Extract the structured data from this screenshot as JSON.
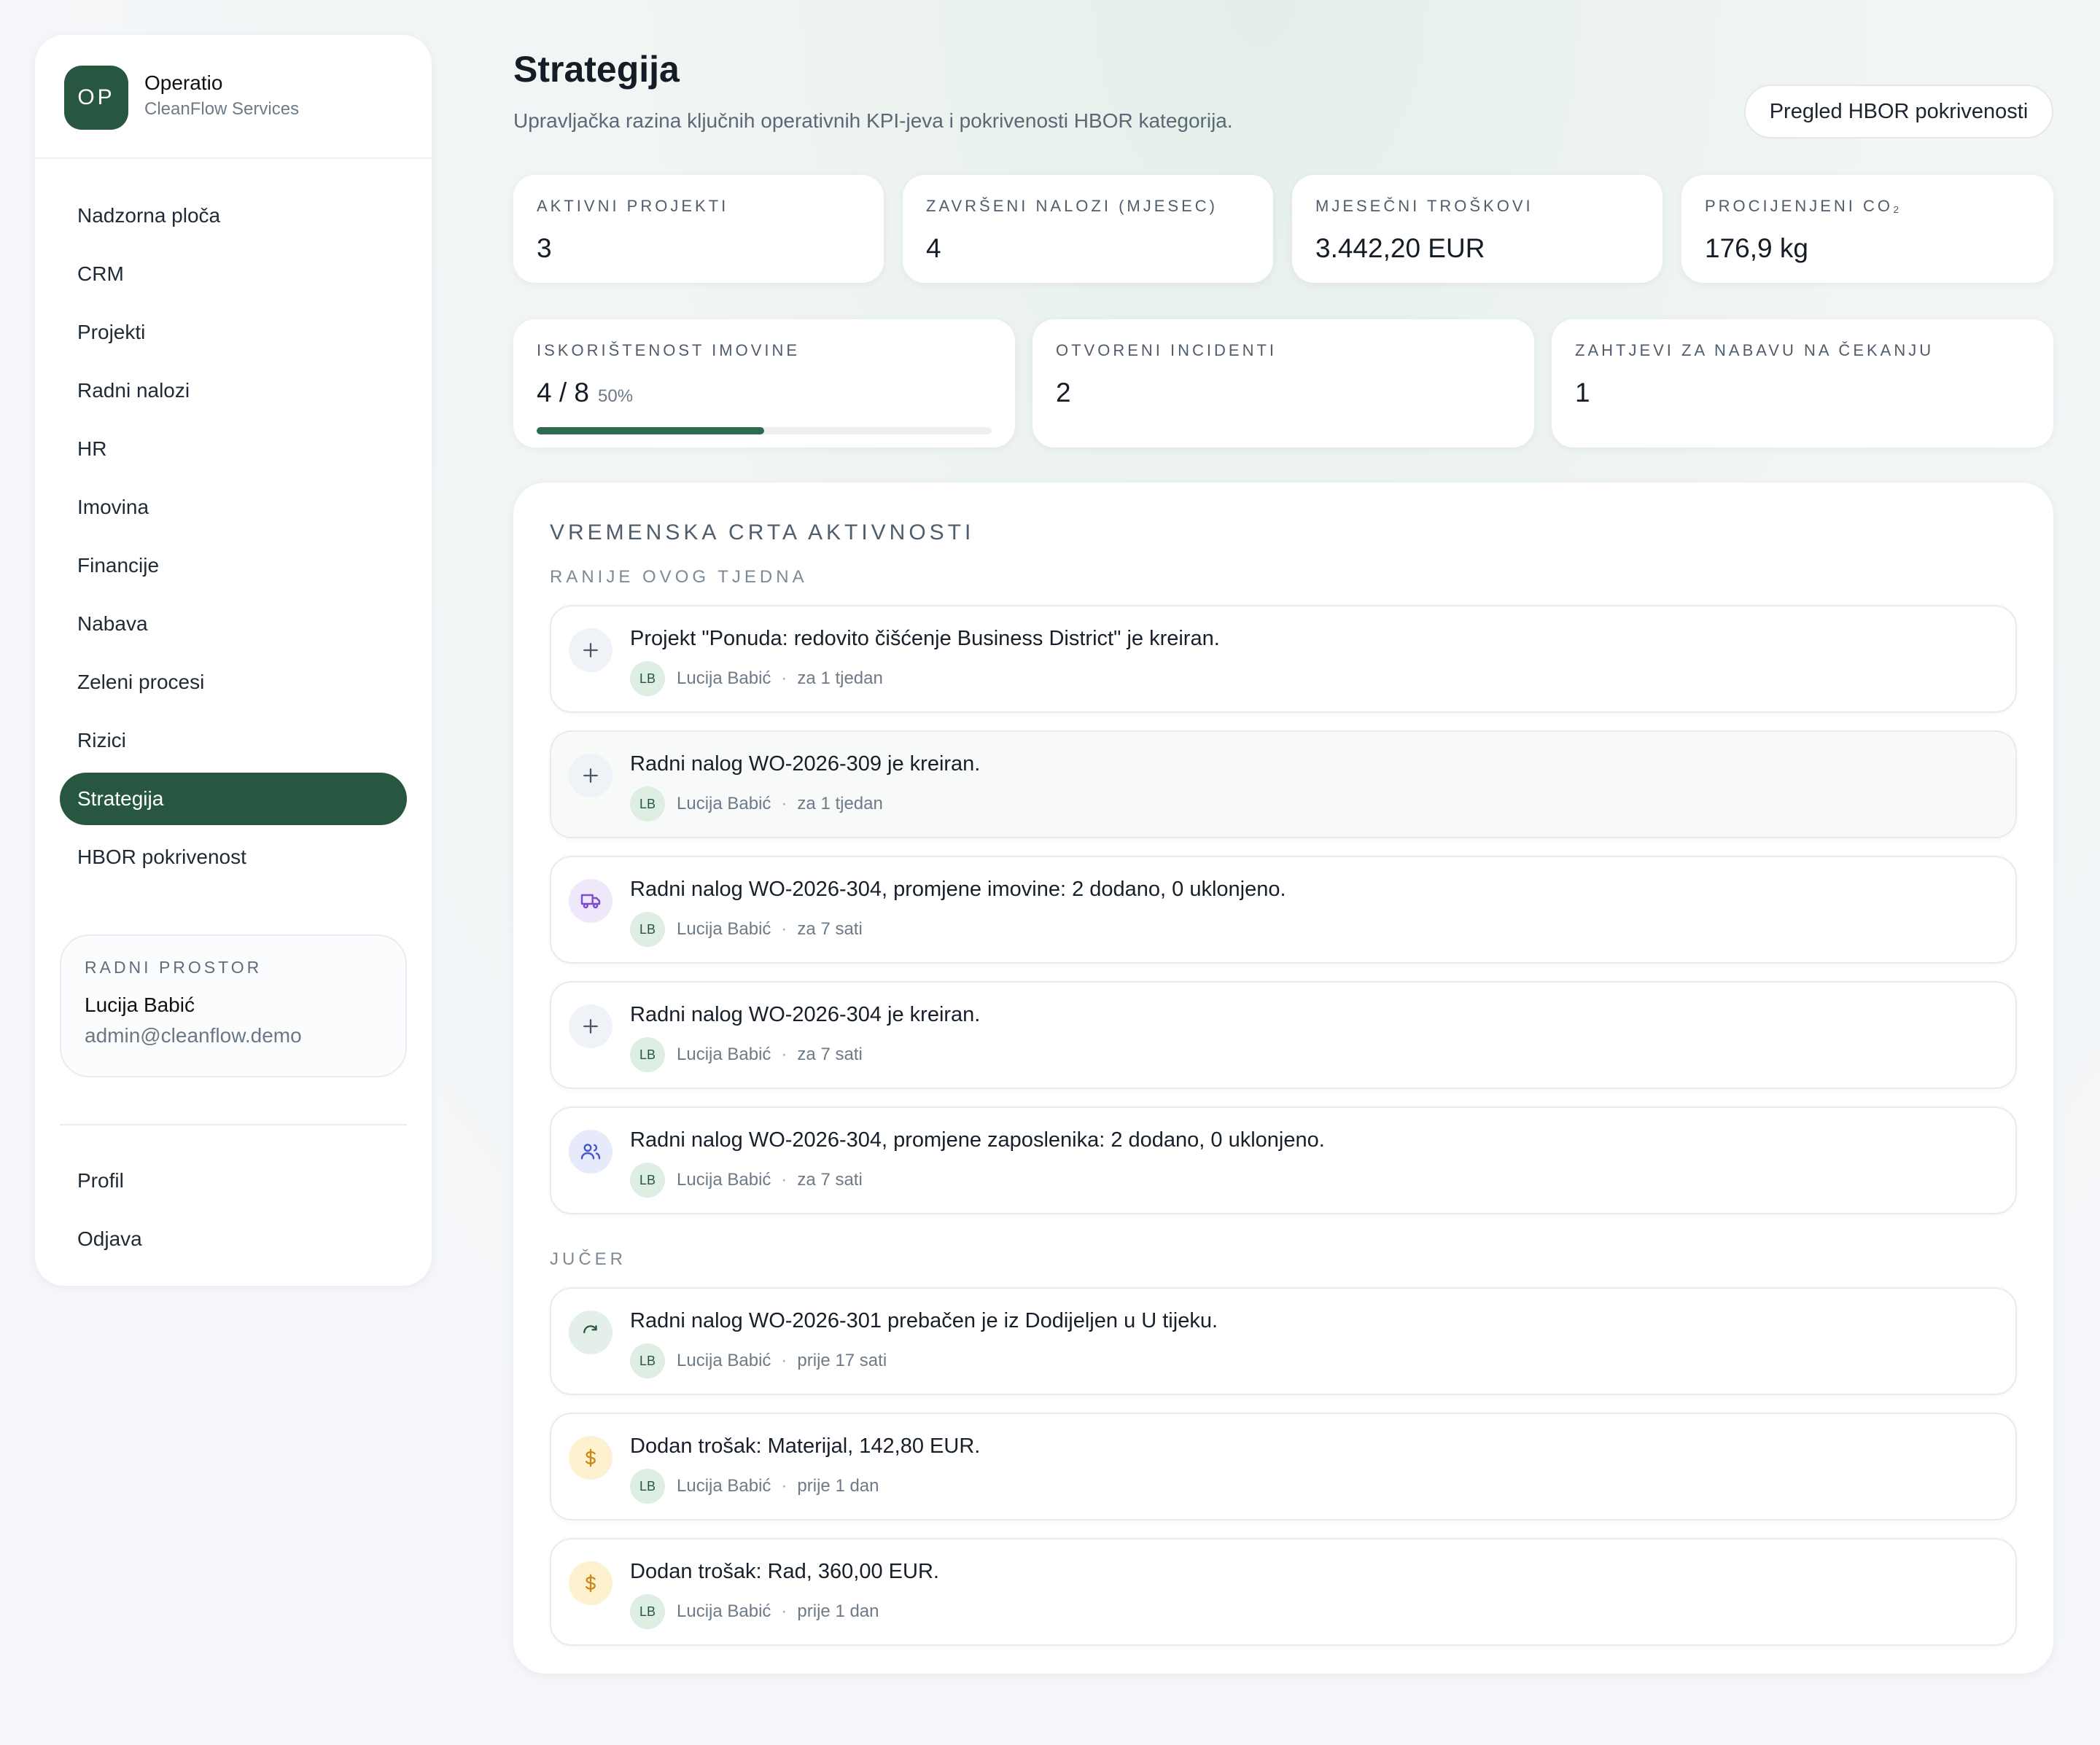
{
  "brand": {
    "logo": "OP",
    "name": "Operatio",
    "sub": "CleanFlow Services"
  },
  "nav": [
    {
      "label": "Nadzorna ploča"
    },
    {
      "label": "CRM"
    },
    {
      "label": "Projekti"
    },
    {
      "label": "Radni nalozi"
    },
    {
      "label": "HR"
    },
    {
      "label": "Imovina"
    },
    {
      "label": "Financije"
    },
    {
      "label": "Nabava"
    },
    {
      "label": "Zeleni procesi"
    },
    {
      "label": "Rizici"
    },
    {
      "label": "Strategija",
      "active": true
    },
    {
      "label": "HBOR pokrivenost"
    }
  ],
  "workspace": {
    "title": "RADNI PROSTOR",
    "name": "Lucija Babić",
    "email": "admin@cleanflow.demo"
  },
  "nav_bottom": [
    {
      "label": "Profil"
    },
    {
      "label": "Odjava"
    }
  ],
  "header": {
    "title": "Strategija",
    "subtitle": "Upravljačka razina ključnih operativnih KPI-jeva i pokrivenosti HBOR kategorija.",
    "button": "Pregled HBOR pokrivenosti"
  },
  "kpis_row1": [
    {
      "label": "AKTIVNI PROJEKTI",
      "value": "3"
    },
    {
      "label": "ZAVRŠENI NALOZI (MJESEC)",
      "value": "4"
    },
    {
      "label": "MJESEČNI TROŠKOVI",
      "value": "3.442,20 EUR"
    },
    {
      "label": "PROCIJENJENI CO₂",
      "value": "176,9 kg"
    }
  ],
  "kpis_row2": [
    {
      "label": "ISKORIŠTENOST IMOVINE",
      "value": "4 / 8",
      "pct": "50%",
      "progress": 0.5
    },
    {
      "label": "OTVORENI INCIDENTI",
      "value": "2"
    },
    {
      "label": "ZAHTJEVI ZA NABAVU NA ČEKANJU",
      "value": "1"
    }
  ],
  "timeline": {
    "title": "VREMENSKA CRTA AKTIVNOSTI",
    "groups": [
      {
        "label": "RANIJE OVOG TJEDNA",
        "events": [
          {
            "icon": "plus-icon",
            "text": "Projekt \"Ponuda: redovito čišćenje Business District\" je kreiran.",
            "initials": "LB",
            "author": "Lucija Babić",
            "time": "za 1 tjedan"
          },
          {
            "icon": "plus-icon",
            "text": "Radni nalog WO-2026-309 je kreiran.",
            "initials": "LB",
            "author": "Lucija Babić",
            "time": "za 1 tjedan"
          },
          {
            "icon": "truck-icon",
            "text": "Radni nalog WO-2026-304, promjene imovine: 2 dodano, 0 uklonjeno.",
            "initials": "LB",
            "author": "Lucija Babić",
            "time": "za 7 sati"
          },
          {
            "icon": "plus-icon",
            "text": "Radni nalog WO-2026-304 je kreiran.",
            "initials": "LB",
            "author": "Lucija Babić",
            "time": "za 7 sati"
          },
          {
            "icon": "people-icon",
            "text": "Radni nalog WO-2026-304, promjene zaposlenika: 2 dodano, 0 uklonjeno.",
            "initials": "LB",
            "author": "Lucija Babić",
            "time": "za 7 sati"
          }
        ]
      },
      {
        "label": "JUČER",
        "events": [
          {
            "icon": "refresh-icon",
            "text": "Radni nalog WO-2026-301 prebačen je iz Dodijeljen u U tijeku.",
            "initials": "LB",
            "author": "Lucija Babić",
            "time": "prije 17 sati"
          },
          {
            "icon": "dollar-icon",
            "text": "Dodan trošak: Materijal, 142,80 EUR.",
            "initials": "LB",
            "author": "Lucija Babić",
            "time": "prije 1 dan"
          },
          {
            "icon": "dollar-icon",
            "text": "Dodan trošak: Rad, 360,00 EUR.",
            "initials": "LB",
            "author": "Lucija Babić",
            "time": "prije 1 dan"
          }
        ]
      }
    ],
    "separator": "·"
  }
}
